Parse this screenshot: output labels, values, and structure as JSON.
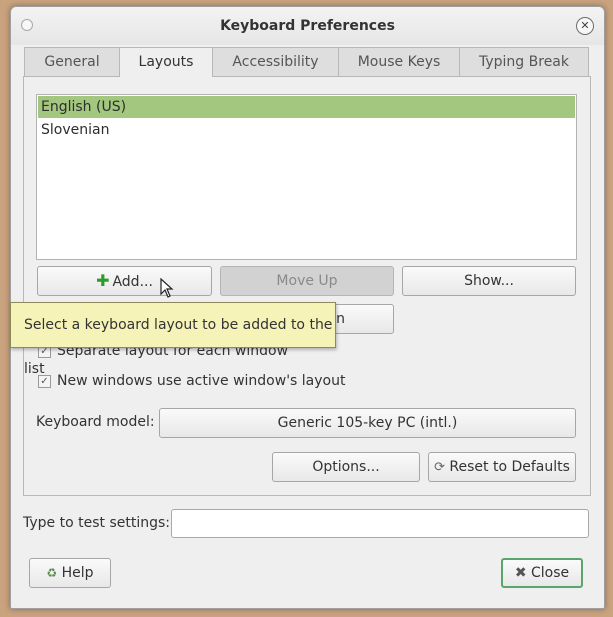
{
  "window": {
    "title": "Keyboard Preferences"
  },
  "tabs": [
    {
      "label": "General"
    },
    {
      "label": "Layouts"
    },
    {
      "label": "Accessibility"
    },
    {
      "label": "Mouse Keys"
    },
    {
      "label": "Typing Break"
    }
  ],
  "active_tab": "Layouts",
  "layouts": {
    "items": [
      {
        "label": "English (US)",
        "selected": true
      },
      {
        "label": "Slovenian",
        "selected": false
      }
    ]
  },
  "buttons": {
    "add": "Add...",
    "move_up": "Move Up",
    "show": "Show...",
    "remove_partial": "n",
    "options": "Options...",
    "reset": "Reset to Defaults",
    "help": "Help",
    "close": "Close"
  },
  "options": {
    "separate_layout": {
      "label": "Separate layout for each window",
      "checked": true
    },
    "new_windows": {
      "label": "New windows use active window's layout",
      "checked": true
    }
  },
  "keyboard_model": {
    "label": "Keyboard model:",
    "value": "Generic 105-key PC (intl.)"
  },
  "test": {
    "label": "Type to test settings:",
    "value": ""
  },
  "tooltip": "Select a keyboard layout to be added to the list",
  "colors": {
    "selection": "#a3c77f",
    "tooltip_bg": "#f6f3b8",
    "close_border": "#5aa66a"
  },
  "icons": {
    "add": "plus-icon",
    "reset": "reset-icon",
    "help": "help-icon",
    "close": "close-icon"
  }
}
